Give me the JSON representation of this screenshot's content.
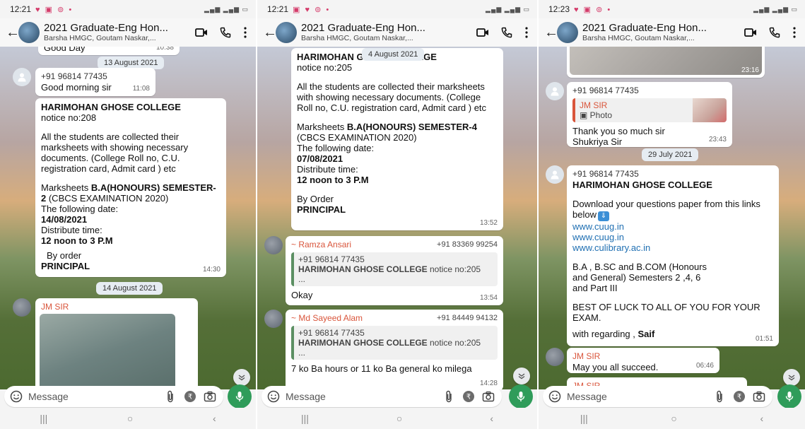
{
  "phones": [
    {
      "status_time": "12:21",
      "title": "2021 Graduate-Eng Hon...",
      "subtitle": "Barsha HMGC, Goutam Naskar,...",
      "message_placeholder": "Message",
      "messages": {
        "top_partial_text": "Good Day",
        "top_partial_time": "10:38",
        "date1": "13 August 2021",
        "m1_sender": "+91 96814 77435",
        "m1_text": "Good morning sir",
        "m1_time": "11:08",
        "m2_l1": "HARIMOHAN GHOSE  COLLEGE",
        "m2_l2": "notice no:208",
        "m2_l3": "All the students are collected their marksheets with showing necessary documents. (College Roll no, C.U. registration card, Admit  card ) etc",
        "m2_l4a": "Marksheets ",
        "m2_l4b": "B.A(HONOURS) SEMESTER-2",
        "m2_l4c": " (CBCS EXAMINATION 2020)",
        "m2_l5": "The following date:",
        "m2_l6": "14/08/2021",
        "m2_l7": "Distribute time:",
        "m2_l8": "12 noon to 3 P.M",
        "m2_l9": "By order",
        "m2_l10": "PRINCIPAL",
        "m2_time": "14:30",
        "date2": "14 August 2021",
        "m3_sender": "JM SIR"
      }
    },
    {
      "status_time": "12:21",
      "title": "2021 Graduate-Eng Hon...",
      "subtitle": "Barsha HMGC, Goutam Naskar,...",
      "message_placeholder": "Message",
      "messages": {
        "m1_l1": "HARIMOHAN GHOSE COLLEGE",
        "date_overlay": "4 August 2021",
        "m1_l2": "notice no:205",
        "m1_l3": "All the students are collected their marksheets with showing necessary documents. (College Roll no, C.U. registration card, Admit  card ) etc",
        "m1_l4a": "Marksheets ",
        "m1_l4b": "B.A(HONOURS) SEMESTER-4",
        "m1_l4c": " (CBCS EXAMINATION 2020)",
        "m1_l5": "The following date:",
        "m1_l6": "07/08/2021",
        "m1_l7": "Distribute time:",
        "m1_l8": "12 noon to 3 P.M",
        "m1_l9": "By Order",
        "m1_l10": "PRINCIPAL",
        "m1_time": "13:52",
        "m2_sender": "~ Ramza Ansari",
        "m2_sender_num": "+91 83369 99254",
        "m2_quote_num": "+91 96814 77435",
        "m2_quote_bold": "HARIMOHAN GHOSE COLLEGE",
        "m2_quote_rest": " notice no:205",
        "m2_quote_more": "...",
        "m2_text": "Okay",
        "m2_time": "13:54",
        "m3_sender": "~ Md Sayeed Alam",
        "m3_sender_num": "+91 84449 94132",
        "m3_quote_num": "+91 96814 77435",
        "m3_quote_bold": "HARIMOHAN GHOSE COLLEGE",
        "m3_quote_rest": " notice no:205",
        "m3_quote_more": "...",
        "m3_text": "7 ko Ba hours or 11 ko Ba general ko milega",
        "m3_time": "14:28"
      }
    },
    {
      "status_time": "12:23",
      "title": "2021 Graduate-Eng Hon...",
      "subtitle": "Barsha HMGC, Goutam Naskar,...",
      "message_placeholder": "Message",
      "messages": {
        "m0_time": "23:16",
        "m1_sender": "+91 96814 77435",
        "m1_quote_name": "JM SIR",
        "m1_quote_type": "Photo",
        "m1_text": "Thank you so much sir Shukriya Sir",
        "m1_time": "23:43",
        "date1": "29 July 2021",
        "m2_sender": "+91 96814 77435",
        "m2_l1": "HARIMOHAN GHOSE COLLEGE",
        "m2_l2": "Download your questions paper from this links below",
        "m2_link1": "www.cuug.in",
        "m2_link2": "www.cuug.in",
        "m2_link3": "www.culibrary.ac.in",
        "m2_l3": "B.A , B.SC and B.COM (Honours and General) Semesters 2 ,4, 6 and Part III",
        "m2_l4": "BEST OF LUCK TO ALL OF YOU FOR YOUR EXAM.",
        "m2_l5a": "with regarding , ",
        "m2_l5b": "Saif",
        "m2_time": "01:51",
        "m3_sender": "JM SIR",
        "m3_text": "May you all succeed.",
        "m3_time": "06:46",
        "m4_sender": "JM SIR"
      }
    }
  ],
  "colors": {
    "mic_green": "#2f9c5a",
    "sender_orange": "#d9553b",
    "link_blue": "#1f6fb2"
  }
}
